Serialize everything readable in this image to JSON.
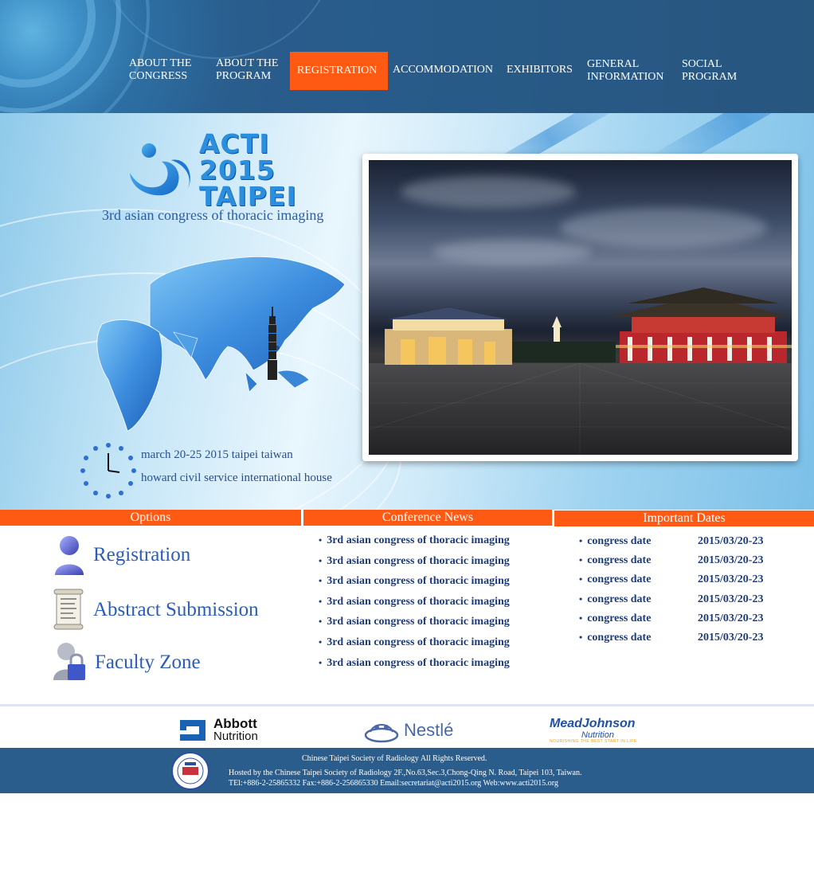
{
  "nav": {
    "items": [
      {
        "label_line1": "ABOUT THE",
        "label_line2": "CONGRESS"
      },
      {
        "label_line1": "ABOUT THE",
        "label_line2": "PROGRAM"
      },
      {
        "label_line1": "REGISTRATION",
        "label_line2": ""
      },
      {
        "label_line1": "ACCOMMODATION",
        "label_line2": ""
      },
      {
        "label_line1": "EXHIBITORS",
        "label_line2": ""
      },
      {
        "label_line1": "GENERAL",
        "label_line2": "INFORMATION"
      },
      {
        "label_line1": "SOCIAL",
        "label_line2": "PROGRAM"
      }
    ],
    "active_color": "#ff5a14"
  },
  "hero": {
    "logo_line1": "ACTI",
    "logo_line2": "2015",
    "logo_line3": "TAIPEI",
    "subtitle": "3rd asian congress of thoracic imaging",
    "event_date": "march 20-25 2015 taipei taiwan",
    "event_venue": "howard civil service international house"
  },
  "sections": {
    "options_title": "Options",
    "news_title": "Conference News",
    "dates_title": "Important Dates"
  },
  "options": [
    {
      "label": "Registration",
      "icon": "user-icon"
    },
    {
      "label": "Abstract Submission",
      "icon": "document-icon"
    },
    {
      "label": "Faculty Zone",
      "icon": "lock-user-icon"
    }
  ],
  "news": [
    "3rd asian congress of thoracic imaging",
    "3rd asian congress of thoracic imaging",
    "3rd asian congress of thoracic imaging",
    "3rd asian congress of thoracic imaging",
    "3rd asian congress of thoracic imaging",
    "3rd asian congress of thoracic imaging",
    "3rd asian congress of thoracic imaging"
  ],
  "dates": [
    {
      "label": "congress date",
      "value": "2015/03/20-23"
    },
    {
      "label": "congress date",
      "value": "2015/03/20-23"
    },
    {
      "label": "congress date",
      "value": "2015/03/20-23"
    },
    {
      "label": "congress date",
      "value": "2015/03/20-23"
    },
    {
      "label": "congress date",
      "value": "2015/03/20-23"
    },
    {
      "label": "congress date",
      "value": "2015/03/20-23"
    }
  ],
  "sponsors": {
    "abbott_line1": "Abbott",
    "abbott_line2": "Nutrition",
    "nestle": "Nestlé",
    "mead_line1": "MeadJohnson",
    "mead_line2": "Nutrition",
    "mead_tagline": "NOURISHING THE BEST START IN LIFE"
  },
  "footer": {
    "rights": "Chinese Taipei Society of Radiology  All Rights Reserved.",
    "hosted": "Hosted by the Chinese Taipei Society of Radiology   2F.,No.63,Sec.3,Chong-Qing N. Road, Taipei 103, Taiwan.",
    "contact": "TEl:+886-2-25865332 Fax:+886-2-256865330     Email:secretariat@acti2015.org Web:www.acti2015.org"
  }
}
